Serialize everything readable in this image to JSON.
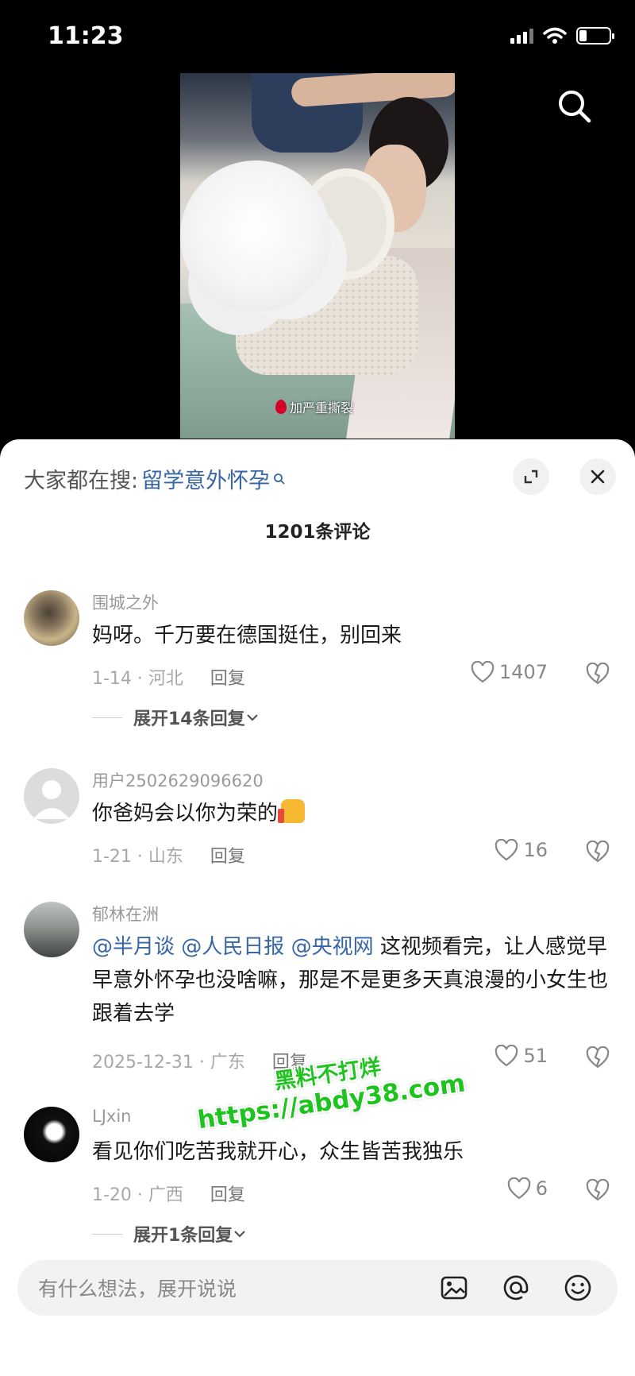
{
  "status_bar": {
    "time": "11:23",
    "battery_level": 0.25
  },
  "video": {
    "caption": "加严重撕裂"
  },
  "panel": {
    "search_prefix": "大家都在搜:",
    "search_keyword": "留学意外怀孕",
    "comment_count": "1201条评论"
  },
  "comments": [
    {
      "username": "围城之外",
      "text": "妈呀。千万要在德国挺住，别回来",
      "date_location": "1-14 · 河北",
      "reply_label": "回复",
      "likes": "1407",
      "expand_replies": "展开14条回复"
    },
    {
      "username": "用户2502629096620",
      "text": "你爸妈会以你为荣的",
      "date_location": "1-21 · 山东",
      "reply_label": "回复",
      "likes": "16"
    },
    {
      "username": "郁林在洲",
      "mentions": [
        "@半月谈",
        "@人民日报",
        "@央视网"
      ],
      "text": "这视频看完，让人感觉早早意外怀孕也没啥嘛，那是不是更多天真浪漫的小女生也跟着去学",
      "date_location": "2025-12-31 · 广东",
      "reply_label": "回复",
      "likes": "51"
    },
    {
      "username": "LJxin",
      "text": "看见你们吃苦我就开心，众生皆苦我独乐",
      "date_location": "1-20 · 广西",
      "reply_label": "回复",
      "likes": "6",
      "expand_replies": "展开1条回复"
    }
  ],
  "watermark": {
    "line1": "黑料不打烊",
    "line2": "https://abdy38.com"
  },
  "input": {
    "placeholder": "有什么想法，展开说说"
  },
  "colors": {
    "link": "#3666a6",
    "watermark": "#1ec41e"
  },
  "icons": [
    "search-icon",
    "expand-icon",
    "close-icon",
    "heart-icon",
    "broken-heart-icon",
    "image-icon",
    "at-icon",
    "emoji-icon"
  ]
}
